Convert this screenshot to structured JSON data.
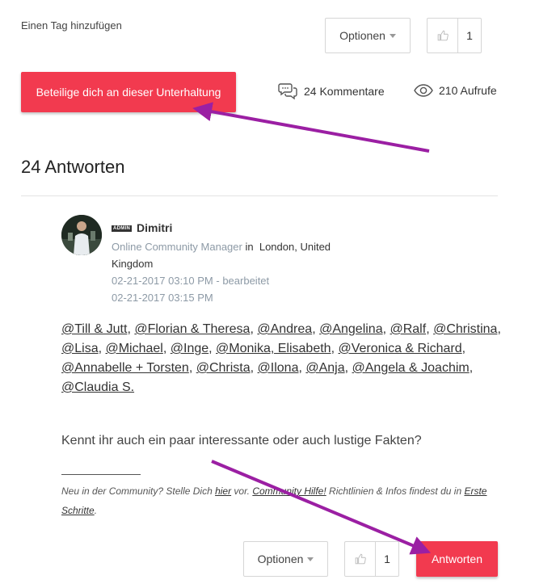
{
  "top": {
    "add_tag": "Einen Tag hinzufügen",
    "options_label": "Optionen",
    "kudo_count": "1",
    "join_button": "Beteilige dich an dieser Unterhaltung",
    "comments": "24 Kommentare",
    "views": "210 Aufrufe"
  },
  "replies_heading": "24 Antworten",
  "post": {
    "badge": "ADMIN",
    "author": "Dimitri",
    "role": "Online Community Manager",
    "in_word": "in",
    "location_line1": "London, United",
    "location_line2": "Kingdom",
    "posted": "02-21-2017 03:10 PM",
    "edited_label": "- bearbeitet",
    "edited": "02-21-2017 03:15 PM",
    "mentions": [
      "@Till & Jutt",
      "@Florian & Theresa",
      "@Andrea",
      "@Angelina",
      "@Ralf",
      "@Christina",
      "@Lisa",
      "@Michael",
      "@Inge",
      "@Monika, Elisabeth",
      "@Veronica & Richard",
      "@Annabelle + Torsten",
      "@Christa",
      "@Ilona",
      "@Anja",
      "@Angela & Joachim",
      "@Claudia S."
    ],
    "question": "Kennt ihr auch ein paar interessante oder auch lustige Fakten?",
    "sig": {
      "part1": "Neu in der Community? Stelle Dich ",
      "link1": "hier",
      "part2": " vor. ",
      "link2": "Community Hilfe!",
      "part3": " Richtlinien & Infos findest du in ",
      "link3": "Erste Schritte",
      "part4": "."
    }
  },
  "bottom": {
    "options_label": "Optionen",
    "kudo_count": "1",
    "reply_button": "Antworten"
  },
  "colors": {
    "accent": "#f23a4f",
    "arrow": "#9b1fa3",
    "muted": "#8d9aa6"
  }
}
